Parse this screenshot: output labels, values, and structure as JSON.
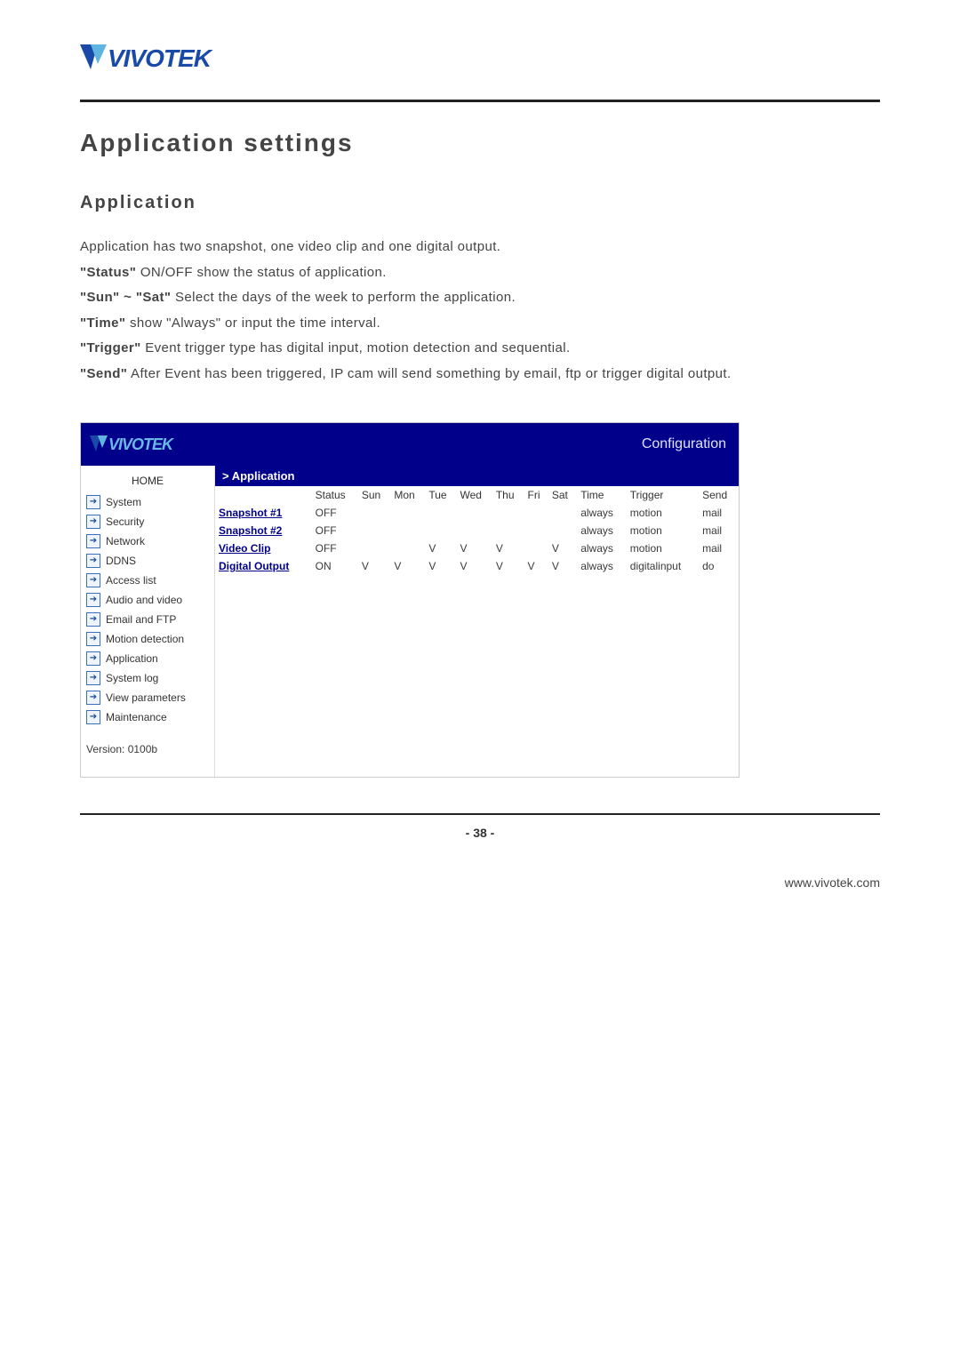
{
  "brand": "VIVOTEK",
  "page_title": "Application settings",
  "sub_title": "Application",
  "desc_lines": [
    {
      "pre": "Application has two snapshot, one video clip and one digital output."
    },
    {
      "bold": "\"Status\"",
      "post": " ON/OFF show the status of application."
    },
    {
      "bold": "\"Sun\" ~ \"Sat\"",
      "post": " Select the days of the week to perform the application."
    },
    {
      "bold": "\"Time\"",
      "post": " show \"Always\" or input the time interval."
    },
    {
      "bold": "\"Trigger\"",
      "post": " Event trigger type has digital input, motion detection and sequential."
    },
    {
      "bold": "\"Send\"",
      "post": " After Event has been triggered, IP cam will send something by email, ftp or trigger digital output."
    }
  ],
  "config_header_right": "Configuration",
  "crumb": "> Application",
  "sidebar": {
    "home": "HOME",
    "items": [
      {
        "label": "System"
      },
      {
        "label": "Security"
      },
      {
        "label": "Network"
      },
      {
        "label": "DDNS"
      },
      {
        "label": "Access list"
      },
      {
        "label": "Audio and video"
      },
      {
        "label": "Email and FTP"
      },
      {
        "label": "Motion detection"
      },
      {
        "label": "Application"
      },
      {
        "label": "System log"
      },
      {
        "label": "View parameters"
      },
      {
        "label": "Maintenance"
      }
    ],
    "version": "Version: 0100b"
  },
  "table": {
    "headers": [
      "",
      "Status",
      "Sun",
      "Mon",
      "Tue",
      "Wed",
      "Thu",
      "Fri",
      "Sat",
      "Time",
      "Trigger",
      "Send"
    ],
    "rows": [
      {
        "name": "Snapshot #1",
        "status": "OFF",
        "sun": "",
        "mon": "",
        "tue": "",
        "wed": "",
        "thu": "",
        "fri": "",
        "sat": "",
        "time": "always",
        "trigger": "motion",
        "send": "mail"
      },
      {
        "name": "Snapshot #2",
        "status": "OFF",
        "sun": "",
        "mon": "",
        "tue": "",
        "wed": "",
        "thu": "",
        "fri": "",
        "sat": "",
        "time": "always",
        "trigger": "motion",
        "send": "mail"
      },
      {
        "name": "Video Clip",
        "status": "OFF",
        "sun": "",
        "mon": "",
        "tue": "V",
        "wed": "V",
        "thu": "V",
        "fri": "",
        "sat": "V",
        "time": "always",
        "trigger": "motion",
        "send": "mail"
      },
      {
        "name": "Digital Output",
        "status": "ON",
        "sun": "V",
        "mon": "V",
        "tue": "V",
        "wed": "V",
        "thu": "V",
        "fri": "V",
        "sat": "V",
        "time": "always",
        "trigger": "digitalinput",
        "send": "do"
      }
    ]
  },
  "page_number": "- 38 -",
  "footer_url": "www.vivotek.com"
}
